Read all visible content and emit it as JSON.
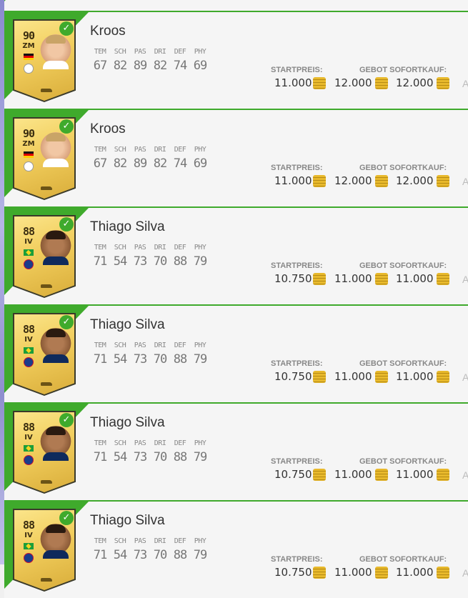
{
  "labels": {
    "start_price": "STARTPREIS:",
    "bid_buy_now": "GEBOT SOFORTKAUF:"
  },
  "stat_labels": [
    "TEM",
    "SCH",
    "PAS",
    "DRI",
    "DEF",
    "PHY"
  ],
  "items": [
    {
      "name": "Kroos",
      "rating": "90",
      "position": "ZM",
      "nation": "germany",
      "club": "real-madrid",
      "skin": "light",
      "stats": [
        "67",
        "82",
        "89",
        "82",
        "74",
        "69"
      ],
      "start_price": "11.000",
      "bid": "12.000",
      "buy_now": "12.000",
      "more": "A"
    },
    {
      "name": "Kroos",
      "rating": "90",
      "position": "ZM",
      "nation": "germany",
      "club": "real-madrid",
      "skin": "light",
      "stats": [
        "67",
        "82",
        "89",
        "82",
        "74",
        "69"
      ],
      "start_price": "11.000",
      "bid": "12.000",
      "buy_now": "12.000",
      "more": "A"
    },
    {
      "name": "Thiago Silva",
      "rating": "88",
      "position": "IV",
      "nation": "brazil",
      "club": "psg",
      "skin": "dark",
      "stats": [
        "71",
        "54",
        "73",
        "70",
        "88",
        "79"
      ],
      "start_price": "10.750",
      "bid": "11.000",
      "buy_now": "11.000",
      "more": "A"
    },
    {
      "name": "Thiago Silva",
      "rating": "88",
      "position": "IV",
      "nation": "brazil",
      "club": "psg",
      "skin": "dark",
      "stats": [
        "71",
        "54",
        "73",
        "70",
        "88",
        "79"
      ],
      "start_price": "10.750",
      "bid": "11.000",
      "buy_now": "11.000",
      "more": "A"
    },
    {
      "name": "Thiago Silva",
      "rating": "88",
      "position": "IV",
      "nation": "brazil",
      "club": "psg",
      "skin": "dark",
      "stats": [
        "71",
        "54",
        "73",
        "70",
        "88",
        "79"
      ],
      "start_price": "10.750",
      "bid": "11.000",
      "buy_now": "11.000",
      "more": "A"
    },
    {
      "name": "Thiago Silva",
      "rating": "88",
      "position": "IV",
      "nation": "brazil",
      "club": "psg",
      "skin": "dark",
      "stats": [
        "71",
        "54",
        "73",
        "70",
        "88",
        "79"
      ],
      "start_price": "10.750",
      "bid": "11.000",
      "buy_now": "11.000",
      "more": "A"
    }
  ],
  "icons": {
    "check": "check-icon",
    "coin": "coins-icon",
    "boot": "boot-icon"
  },
  "colors": {
    "accent_green": "#3faa2c",
    "card_gold": "#f1cd5c"
  }
}
